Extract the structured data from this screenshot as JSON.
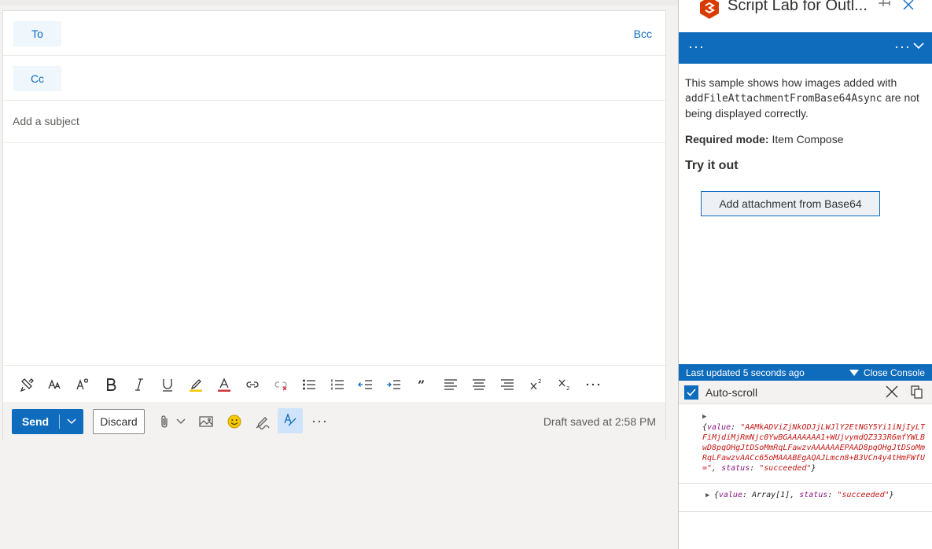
{
  "compose": {
    "to_label": "To",
    "cc_label": "Cc",
    "bcc_label": "Bcc",
    "subject_placeholder": "Add a subject"
  },
  "formatting_toolbar": {
    "icons": [
      "format-painter-icon",
      "font-size-icon",
      "text-effects-icon",
      "bold-icon",
      "italic-icon",
      "underline-icon",
      "highlight-icon",
      "font-color-icon",
      "link-icon",
      "unlink-icon",
      "bullets-icon",
      "numbering-icon",
      "decrease-indent-icon",
      "increase-indent-icon",
      "quote-icon",
      "align-left-icon",
      "align-center-icon",
      "align-right-icon",
      "superscript-icon",
      "subscript-icon",
      "more-options-icon"
    ]
  },
  "action_bar": {
    "send_label": "Send",
    "discard_label": "Discard",
    "draft_status": "Draft saved at 2:58 PM"
  },
  "addin": {
    "title": "Script Lab for Outl...",
    "description_prefix": "This sample shows how images added with ",
    "description_code": "addFileAttachmentFromBase64Async",
    "description_suffix": " are not being displayed correctly.",
    "required_mode_label": "Required mode:",
    "required_mode_value": "Item Compose",
    "try_heading": "Try it out",
    "add_button_label": "Add attachment from Base64",
    "last_updated": "Last updated 5 seconds ago",
    "close_console_label": "Close Console",
    "autoscroll_label": "Auto-scroll",
    "log1": {
      "value_key": "value",
      "value": "\"AAMkADViZjNkODJjLWJlY2EtNGY5Yi1iNjIyLTFiMjdiMjRmNjc0YwBGAAAAAAA1+WUjvymdQZ333R6mfYWLBwD8pqOHgJtDSoMmRqLFawzvAAAAAAEPAAD8pqOHgJtDSoMmRqLFawzvAACc65oMAAABEgAQAJLmcn8+B3VCn4y4tHmFWfU=\"",
      "status_key": "status",
      "status": "\"succeeded\""
    },
    "log2": {
      "value_key": "value",
      "value": "Array[1]",
      "status_key": "status",
      "status": "\"succeeded\""
    }
  },
  "colors": {
    "accent": "#0f6cbd",
    "active_tool_bg": "#cfe4fa",
    "log_key": "#881280",
    "log_string": "#c41a16"
  }
}
